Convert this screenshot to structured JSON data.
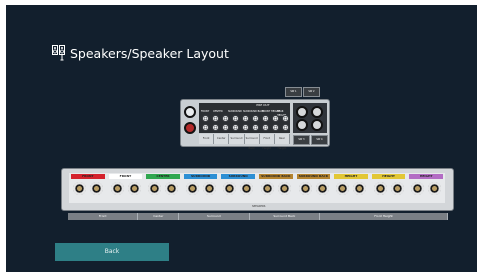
{
  "title": "Speakers/Speaker Layout",
  "icon": "speakers-icon",
  "preout": {
    "label": "PRE OUT",
    "headers": [
      "FRONT",
      "CENTER",
      "SURROUND",
      "SURROUND BACK",
      "FRONT HEIGHT",
      "REAR HEIGHT"
    ],
    "labels": [
      "Front",
      "Center",
      "Surround",
      "Surround Back",
      "Front Height",
      "Rear Height"
    ],
    "ext": [
      "SW 1",
      "SW 2",
      "SW 3",
      "SW 4"
    ]
  },
  "speakers": {
    "groups": [
      {
        "name": "FRONT",
        "color": "#d4222d"
      },
      {
        "name": "FRONT",
        "color": "#ffffff"
      },
      {
        "name": "CENTER",
        "color": "#30a74f"
      },
      {
        "name": "SURROUND",
        "color": "#2d8fd4"
      },
      {
        "name": "SURROUND",
        "color": "#2d8fd4"
      },
      {
        "name": "SURROUND BACK",
        "color": "#b4832f"
      },
      {
        "name": "SURROUND BACK",
        "color": "#b4832f"
      },
      {
        "name": "HEIGHT",
        "color": "#e2c735"
      },
      {
        "name": "HEIGHT",
        "color": "#e2c735"
      },
      {
        "name": "HEIGHT",
        "color": "#b36cc4"
      }
    ],
    "panel_label": "SPEAKERS",
    "bottom_labels": [
      "Front",
      "Center",
      "Surround",
      "Surround Back",
      "Front Height"
    ]
  },
  "back_button": "Back"
}
